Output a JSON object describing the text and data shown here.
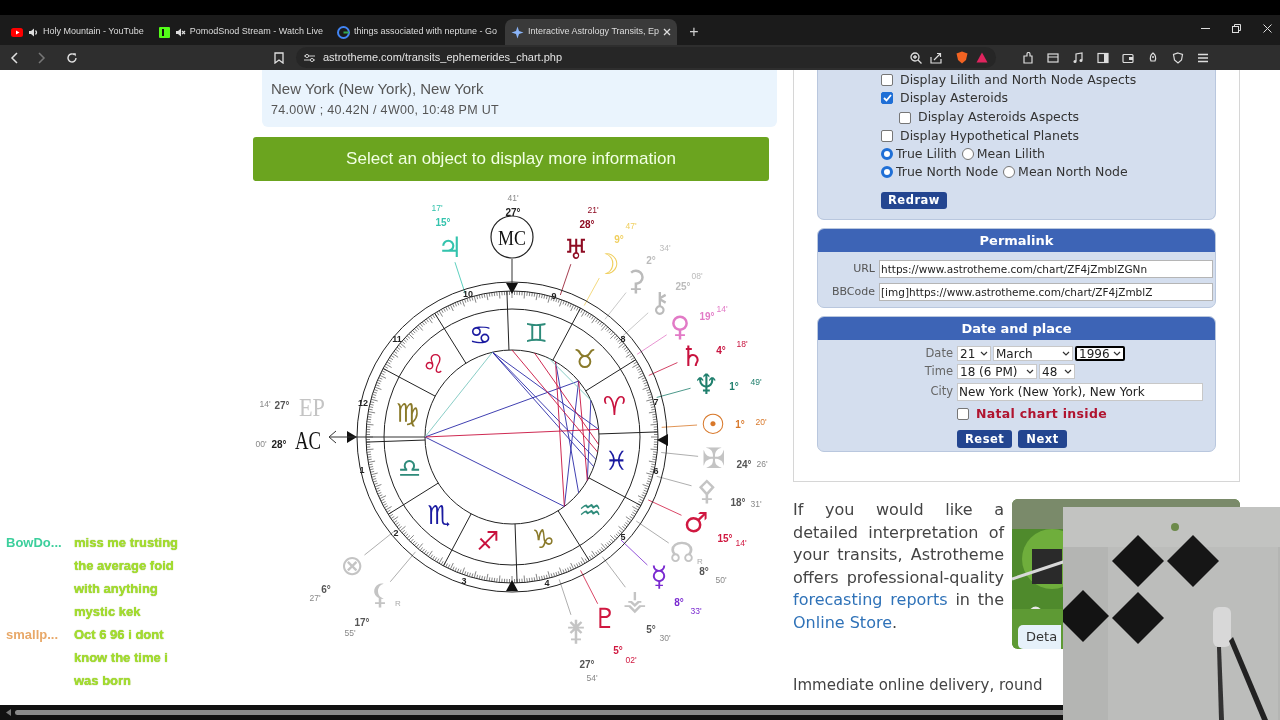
{
  "browser": {
    "tabs": [
      {
        "title": "Holy Mountain - YouTube",
        "muted": false,
        "selected": false
      },
      {
        "title": "PomodSnod Stream - Watch Live",
        "muted": true,
        "selected": false
      },
      {
        "title": "things associated with neptune - Go",
        "selected": false
      },
      {
        "title": "Interactive Astrology Transits, Ep",
        "selected": true
      }
    ],
    "new_tab": "+",
    "address": "astrotheme.com/transits_ephemerides_chart.php"
  },
  "location": {
    "place": "New York (New York), New York",
    "coordinates": "74.00W ; 40.42N / 4W00, 10:48 PM UT"
  },
  "banner": "Select an object to display more information",
  "wheel": {
    "signs": [
      {
        "glyph": "♈",
        "color": "#c8123e"
      },
      {
        "glyph": "♉",
        "color": "#8a7a2a"
      },
      {
        "glyph": "♊",
        "color": "#2e8b7a"
      },
      {
        "glyph": "♋",
        "color": "#1a1aa0"
      },
      {
        "glyph": "♌",
        "color": "#c8123e"
      },
      {
        "glyph": "♍",
        "color": "#8a7a2a"
      },
      {
        "glyph": "♎",
        "color": "#2e8b7a"
      },
      {
        "glyph": "♏",
        "color": "#1a1aa0"
      },
      {
        "glyph": "♐",
        "color": "#c8123e"
      },
      {
        "glyph": "♑",
        "color": "#8a7a2a"
      },
      {
        "glyph": "♒",
        "color": "#2e8b7a"
      },
      {
        "glyph": "♓",
        "color": "#1a1aa0"
      }
    ],
    "houses": [
      "10",
      "9",
      "8",
      "7",
      "6",
      "5",
      "4",
      "3",
      "2",
      "1",
      "12",
      "11"
    ],
    "points": [
      {
        "kind": "planet",
        "glyph": "♃",
        "color": "#33c3ad",
        "degree": "15°",
        "minute": "17'"
      },
      {
        "kind": "angle",
        "glyph": "MC",
        "color": "#111111",
        "degree": "27°",
        "minute": "41'"
      },
      {
        "kind": "planet",
        "glyph": "♅",
        "color": "#8e0b22",
        "degree": "28°",
        "minute": "21'"
      },
      {
        "kind": "planet",
        "glyph": "☽",
        "color": "#f0cf5e",
        "degree": "9°",
        "minute": "47'"
      },
      {
        "kind": "planet",
        "glyph": "⚳",
        "color": "#bbbbbb",
        "degree": "2°",
        "minute": "34'"
      },
      {
        "kind": "planet",
        "glyph": "⚷",
        "color": "#bbbbbb",
        "degree": "25°",
        "minute": "08'"
      },
      {
        "kind": "planet",
        "glyph": "♀",
        "color": "#e27ac6",
        "degree": "19°",
        "minute": "14'"
      },
      {
        "kind": "planet",
        "glyph": "♄",
        "color": "#c8123e",
        "degree": "4°",
        "minute": "18'"
      },
      {
        "kind": "planet",
        "glyph": "♆",
        "color": "#1f7f6d",
        "degree": "1°",
        "minute": "49'"
      },
      {
        "kind": "planet",
        "glyph": "☉",
        "color": "#d8782a",
        "degree": "1°",
        "minute": "20'"
      },
      {
        "kind": "planet",
        "glyph": "✠",
        "color": "#c4c4c4",
        "degree": "24°",
        "minute": "26'"
      },
      {
        "kind": "planet",
        "glyph": "⚴",
        "color": "#c4c4c4",
        "degree": "18°",
        "minute": "31'"
      },
      {
        "kind": "planet",
        "glyph": "♂",
        "color": "#d01840",
        "degree": "15°",
        "minute": "14'"
      },
      {
        "kind": "planet",
        "glyph": "☊",
        "color": "#c4c4c4",
        "degree": "8°",
        "minute": "50'",
        "retrograde": "R"
      },
      {
        "kind": "planet",
        "glyph": "☿",
        "color": "#7a2ad0",
        "degree": "8°",
        "minute": "33'"
      },
      {
        "kind": "planet",
        "glyph": "⚶",
        "color": "#c4c4c4",
        "degree": "5°",
        "minute": "30'"
      },
      {
        "kind": "planet",
        "glyph": "♇",
        "color": "#d01840",
        "degree": "5°",
        "minute": "02'"
      },
      {
        "kind": "planet",
        "glyph": "⚵",
        "color": "#c4c4c4",
        "degree": "27°",
        "minute": "54'"
      },
      {
        "kind": "planet",
        "glyph": "⚸",
        "color": "#c4c4c4",
        "degree": "17°",
        "minute": "55'",
        "retrograde": "R"
      },
      {
        "kind": "planet",
        "glyph": "⊗",
        "color": "#c4c4c4",
        "degree": "6°",
        "minute": "27'"
      },
      {
        "kind": "angle",
        "glyph": "EP",
        "color": "#c4c4c4",
        "degree": "27°",
        "minute": "14'"
      },
      {
        "kind": "angle",
        "glyph": "AC",
        "color": "#111111",
        "degree": "28°",
        "minute": "00'"
      }
    ]
  },
  "options": [
    {
      "kind": "checkbox",
      "label": "Display Lilith and North Node Aspects",
      "checked": false
    },
    {
      "kind": "checkbox",
      "label": "Display Asteroids",
      "checked": true,
      "children": [
        {
          "kind": "checkbox",
          "label": "Display Asteroids Aspects",
          "checked": false
        }
      ]
    },
    {
      "kind": "checkbox",
      "label": "Display Hypothetical Planets",
      "checked": false
    },
    {
      "kind": "radio_group",
      "choices": [
        {
          "label": "True Lilith",
          "selected": true
        },
        {
          "label": "Mean Lilith",
          "selected": false
        }
      ]
    },
    {
      "kind": "radio_group",
      "choices": [
        {
          "label": "True North Node",
          "selected": true
        },
        {
          "label": "Mean North Node",
          "selected": false
        }
      ]
    }
  ],
  "redraw": "Redraw",
  "permalink": {
    "title": "Permalink",
    "fields": [
      {
        "label": "URL",
        "value": "https://www.astrotheme.com/chart/ZF4jZmblZGNn"
      },
      {
        "label": "BBCode",
        "value": "[img]https://www.astrotheme.com/chart/ZF4jZmblZ"
      }
    ]
  },
  "date_place": {
    "title": "Date and place",
    "date": {
      "label": "Date",
      "selects": [
        {
          "value": "21",
          "focused": false
        },
        {
          "value": "March",
          "focused": false
        },
        {
          "value": "1996",
          "focused": true
        }
      ]
    },
    "time": {
      "label": "Time",
      "selects": [
        {
          "value": "18 (6 PM)",
          "focused": false
        },
        {
          "value": "48",
          "focused": false
        }
      ]
    },
    "city": {
      "label": "City",
      "value": "New York (New York), New York"
    },
    "natal": {
      "label": "Natal chart inside",
      "checked": false
    },
    "buttons": [
      "Reset",
      "Next"
    ]
  },
  "promo": {
    "parts": [
      {
        "text": "If you would like a detailed interpretation of your transits, Astrotheme offers professional-quality ",
        "link": false
      },
      {
        "text": "forecasting reports",
        "link": true
      },
      {
        "text": " in the ",
        "link": false
      },
      {
        "text": "Online Store",
        "link": true
      },
      {
        "text": ".",
        "link": false
      }
    ],
    "image_button": "Deta",
    "delivery": "Immediate online delivery, round"
  },
  "chat": [
    {
      "user": "BowDo...",
      "color": "#3ccf9c",
      "message": "miss me trusting the average foid with anything mystic kek"
    },
    {
      "user": "smallp...",
      "color": "#e8a868",
      "message": "Oct 6 96 i dont know the time i was born"
    }
  ]
}
